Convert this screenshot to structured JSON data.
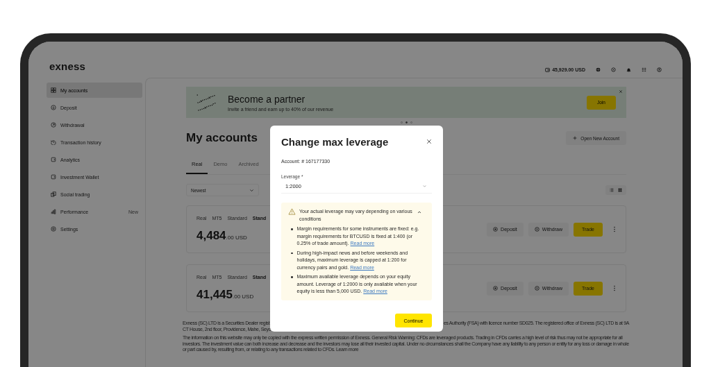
{
  "header": {
    "logo": "exness",
    "balance": "45,929.00 USD"
  },
  "sidebar": {
    "items": [
      {
        "label": "My accounts",
        "selected": true
      },
      {
        "label": "Deposit",
        "selected": false
      },
      {
        "label": "Withdrawal",
        "selected": false
      },
      {
        "label": "Transaction history",
        "selected": false
      },
      {
        "label": "Analytics",
        "selected": false
      },
      {
        "label": "Investment Wallet",
        "selected": false
      },
      {
        "label": "Social trading",
        "selected": false
      },
      {
        "label": "Performance",
        "selected": false,
        "badge": "New"
      },
      {
        "label": "Settings",
        "selected": false
      }
    ]
  },
  "banner": {
    "title": "Become a partner",
    "subtitle": "Invite a friend and earn up to 40% of our revenue",
    "button": "Join",
    "dots": [
      {
        "selected": false
      },
      {
        "selected": true
      },
      {
        "selected": false
      }
    ]
  },
  "page": {
    "title": "My accounts",
    "new_account_button": "Open New Account",
    "tabs": [
      {
        "label": "Real",
        "selected": true
      },
      {
        "label": "Demo",
        "selected": false
      },
      {
        "label": "Archived",
        "selected": false
      }
    ],
    "sort": "Newest"
  },
  "accounts": [
    {
      "tags": [
        "Real",
        "MT5",
        "Standard"
      ],
      "name": "Stand",
      "balance": "4,484",
      "fraction": ".00 USD",
      "actions": [
        "Deposit",
        "Withdraw",
        "Trade"
      ]
    },
    {
      "tags": [
        "Real",
        "MT5",
        "Standard"
      ],
      "name": "Stand",
      "balance": "41,445",
      "fraction": ".00 USD",
      "actions": [
        "Deposit",
        "Withdraw",
        "Trade"
      ]
    }
  ],
  "footer": {
    "line1_left": "Exness (SC) LTD is a Securities Dealer regist",
    "line1_right": "es Authority (FSA) with licence number SD025. The registered office of Exness (SC) LTD is at 9A",
    "line2_left": "CT House, 2nd floor, Providence, Mahe, Seyc",
    "paragraph": "The information on this website may only be copied with the express written permission of Exness. General Risk Warning: CFDs are leveraged products. Trading in CFDs carries a high level of risk thus may not be appropriate for all investors. The investment value can both increase and decrease and the investors may lose all their invested capital. Under no circumstances shall the Company have any liability to any person or entity for any loss or damage in whole or part caused by, resulting from, or relating to any transactions related to CFDs.",
    "paragraph_link": "Learn more"
  },
  "modal": {
    "title": "Change max leverage",
    "account": "Account: # 167177330",
    "leverage_label": "Leverage *",
    "leverage_value": "1:2000",
    "notice": {
      "title": "Your actual leverage may vary depending on various conditions",
      "expanded": true,
      "items": [
        {
          "text": "Margin requirements for some instruments are fixed: e.g. margin requirements for BTCUSD is fixed at 1:400 (or 0.25% of trade amount).",
          "link": "Read more"
        },
        {
          "text": "During high-impact news and before weekends and holidays, maximum leverage is capped at 1:200 for currency pairs and gold.",
          "link": "Read more"
        },
        {
          "text": "Maximum available leverage depends on your equity amount. Leverage of 1:2000 is only available when your equity is less than 5,000 USD.",
          "link": "Read more"
        }
      ]
    },
    "button": "Continue"
  }
}
